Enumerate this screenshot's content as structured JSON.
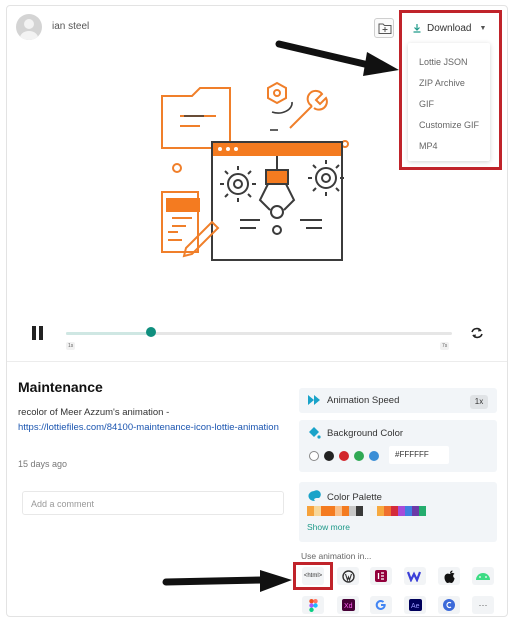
{
  "header": {
    "username": "ian steel",
    "download_label": "Download"
  },
  "download_menu": [
    "Lottie JSON",
    "ZIP Archive",
    "GIF",
    "Customize GIF",
    "MP4"
  ],
  "player": {
    "start_label": "1s",
    "end_label": "7s",
    "progress": 0.22
  },
  "animation": {
    "title": "Maintenance",
    "description": "recolor of Meer Azzum's animation -",
    "link": "https://lottiefiles.com/84100-maintenance-icon-lottie-animation",
    "posted": "15 days ago",
    "comment_placeholder": "Add a comment"
  },
  "panels": {
    "speed_label": "Animation Speed",
    "speed_value": "1x",
    "bg_label": "Background Color",
    "bg_value": "#FFFFFF",
    "bg_colors": [
      "#ffffff",
      "#222222",
      "#d2262c",
      "#2fa854",
      "#3a8ed6"
    ],
    "palette_label": "Color Palette",
    "palette_a": [
      "#f6a23c",
      "#f7d79a",
      "#f47b20",
      "#f47b20",
      "#f9c08a",
      "#f47b20",
      "#c7c7c7",
      "#3a3a3a"
    ],
    "palette_b": [
      "#f2f2f2",
      "#f7a93f",
      "#ef6f2e",
      "#d42b3a",
      "#a64bd9",
      "#3f7fe0",
      "#6b3aa8",
      "#25ad6e"
    ],
    "show_more": "Show more"
  },
  "use_in": {
    "label": "Use animation in...",
    "html_tile": "<html>",
    "more_tile": "···"
  }
}
